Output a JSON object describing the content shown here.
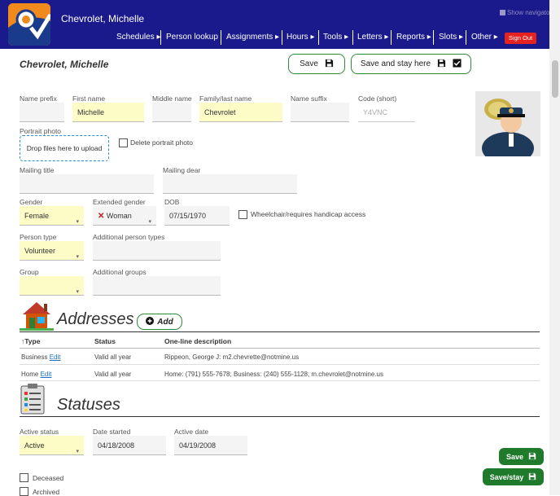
{
  "header": {
    "user_name": "Chevrolet, Michelle",
    "show_navigator": "Show navigator",
    "sign_out": "Sign Out",
    "nav": [
      {
        "label": "Schedules ▸"
      },
      {
        "label": "Person lookup"
      },
      {
        "label": "Assignments ▸"
      },
      {
        "label": "Hours ▸"
      },
      {
        "label": "Tools ▸"
      },
      {
        "label": "Letters ▸"
      },
      {
        "label": "Reports ▸"
      },
      {
        "label": "Slots ▸"
      },
      {
        "label": "Other ▸"
      }
    ]
  },
  "title": "Chevrolet, Michelle",
  "buttons": {
    "save": "Save",
    "save_stay": "Save and stay here",
    "save_small": "Save",
    "save_stay_small": "Save/stay",
    "add": "Add"
  },
  "name": {
    "prefix_label": "Name prefix",
    "prefix_value": "",
    "first_label": "First name",
    "first_value": "Michelle",
    "middle_label": "Middle name",
    "middle_value": "",
    "last_label": "Family/last name",
    "last_value": "Chevrolet",
    "suffix_label": "Name suffix",
    "suffix_value": "",
    "code_label": "Code (short)",
    "code_value": "Y4VNC"
  },
  "portrait": {
    "label": "Portrait photo",
    "drop_text": "Drop files here to upload",
    "delete_label": "Delete portrait photo"
  },
  "mailing": {
    "title_label": "Mailing title",
    "title_value": "",
    "dear_label": "Mailing dear",
    "dear_value": ""
  },
  "demographics": {
    "gender_label": "Gender",
    "gender_value": "Female",
    "ext_gender_label": "Extended gender",
    "ext_gender_value": "Woman",
    "dob_label": "DOB",
    "dob_value": "07/15/1970",
    "wheelchair_label": "Wheelchair/requires handicap access"
  },
  "person_type": {
    "label": "Person type",
    "value": "Volunteer",
    "additional_label": "Additional person types",
    "additional_value": ""
  },
  "group": {
    "label": "Group",
    "value": "",
    "additional_label": "Additional groups",
    "additional_value": ""
  },
  "addresses": {
    "title": "Addresses",
    "columns": [
      "↑Type",
      "Status",
      "One-line description"
    ],
    "edit_label": "Edit",
    "rows": [
      {
        "type": "Business",
        "status": "Valid all year",
        "description": "Rippeon, George J: m2.chevrette@notmine.us"
      },
      {
        "type": "Home",
        "status": "Valid all year",
        "description": "Home: (791) 555-7678; Business: (240) 555-1128; m.chevrolet@notmine.us"
      }
    ]
  },
  "statuses": {
    "title": "Statuses",
    "active_label": "Active status",
    "active_value": "Active",
    "date_started_label": "Date started",
    "date_started_value": "04/18/2008",
    "active_date_label": "Active date",
    "active_date_value": "04/19/2008",
    "deceased_label": "Deceased",
    "archived_label": "Archived"
  },
  "colors": {
    "header_bg": "#1a1a8c",
    "accent_green": "#1f7a2b",
    "required_field": "#fdfbc6",
    "sign_out": "#e52222",
    "link": "#1a6fc0"
  }
}
